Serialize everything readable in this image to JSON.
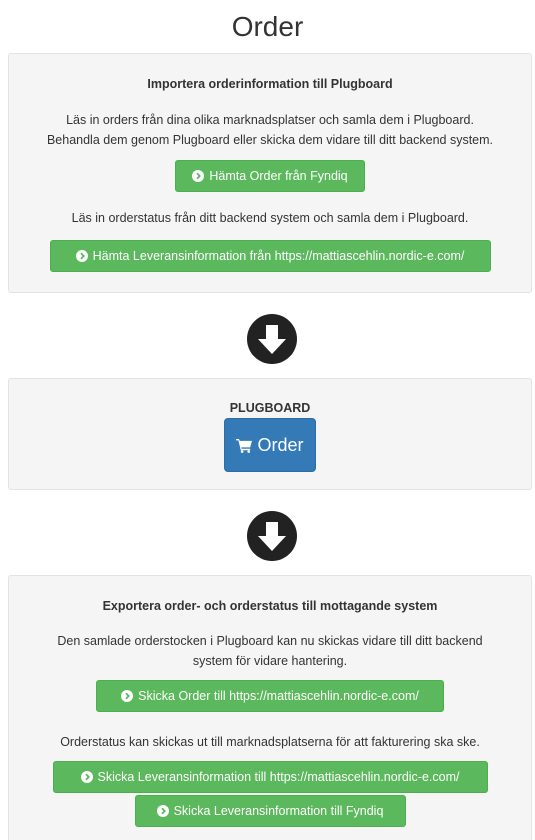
{
  "page": {
    "title": "Order"
  },
  "import_panel": {
    "heading": "Importera orderinformation till Plugboard",
    "text1_line1": "Läs in orders från dina olika marknadsplatser och samla dem i Plugboard.",
    "text1_line2": "Behandla dem genom Plugboard eller skicka dem vidare till ditt backend system.",
    "button_fetch_orders": "Hämta Order från Fyndiq",
    "text2": "Läs in orderstatus från ditt backend system och samla dem i Plugboard.",
    "button_fetch_delivery": "Hämta Leveransinformation från https://mattiascehlin.nordic-e.com/"
  },
  "plugboard_panel": {
    "heading": "PLUGBOARD",
    "order_button": "Order"
  },
  "export_panel": {
    "heading": "Exportera order- och orderstatus till mottagande system",
    "text1_line1": "Den samlade orderstocken i Plugboard kan nu skickas vidare till ditt backend",
    "text1_line2": "system för vidare hantering.",
    "button_send_orders": "Skicka Order till https://mattiascehlin.nordic-e.com/",
    "text2": "Orderstatus kan skickas ut till marknadsplatserna för att fakturering ska ske.",
    "button_send_delivery_backend": "Skicka Leveransinformation till https://mattiascehlin.nordic-e.com/",
    "button_send_delivery_fyndiq": "Skicka Leveransinformation till Fyndiq"
  },
  "icons": {
    "button_icon": "chevron-circle-right-icon",
    "arrow_icon": "arrow-circle-down-icon",
    "cart_icon": "shopping-cart-icon"
  },
  "colors": {
    "success": "#5cb85c",
    "primary": "#337ab7",
    "panel_bg": "#f5f5f5",
    "arrow": "#222222"
  }
}
